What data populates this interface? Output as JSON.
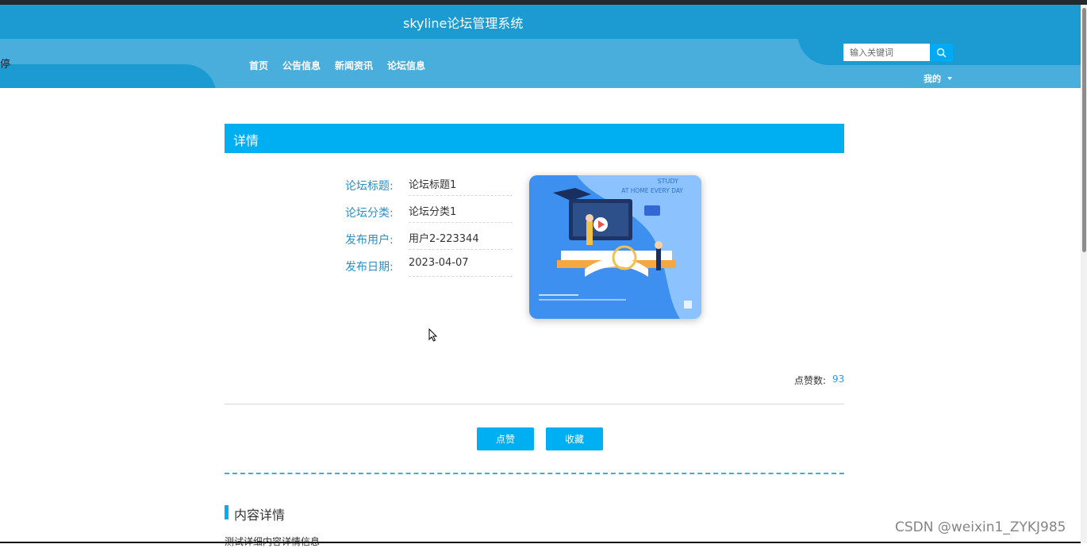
{
  "header": {
    "site_title": "skyline论坛管理系统",
    "left_fragment": "停",
    "nav": [
      "首页",
      "公告信息",
      "新闻资讯",
      "论坛信息"
    ],
    "search_placeholder": "输入关键词",
    "my_label": "我的"
  },
  "detail": {
    "title": "详情",
    "fields": [
      {
        "label": "论坛标题:",
        "value": "论坛标题1"
      },
      {
        "label": "论坛分类:",
        "value": "论坛分类1"
      },
      {
        "label": "发布用户:",
        "value": "用户2-223344"
      },
      {
        "label": "发布日期:",
        "value": "2023-04-07"
      }
    ],
    "image_text_top": "STUDY",
    "image_text_sub": "AT HOME EVERY DAY",
    "likes_label": "点赞数:",
    "likes_count": "93",
    "like_button": "点赞",
    "favorite_button": "收藏"
  },
  "content": {
    "section_title": "内容详情",
    "text": "测试详细内容详情信息"
  },
  "watermark": "CSDN @weixin1_ZYKJ985",
  "colors": {
    "primary": "#00aef2",
    "header": "#4aaedd",
    "header_dark": "#1b9bd1",
    "label": "#2b8fc5"
  }
}
